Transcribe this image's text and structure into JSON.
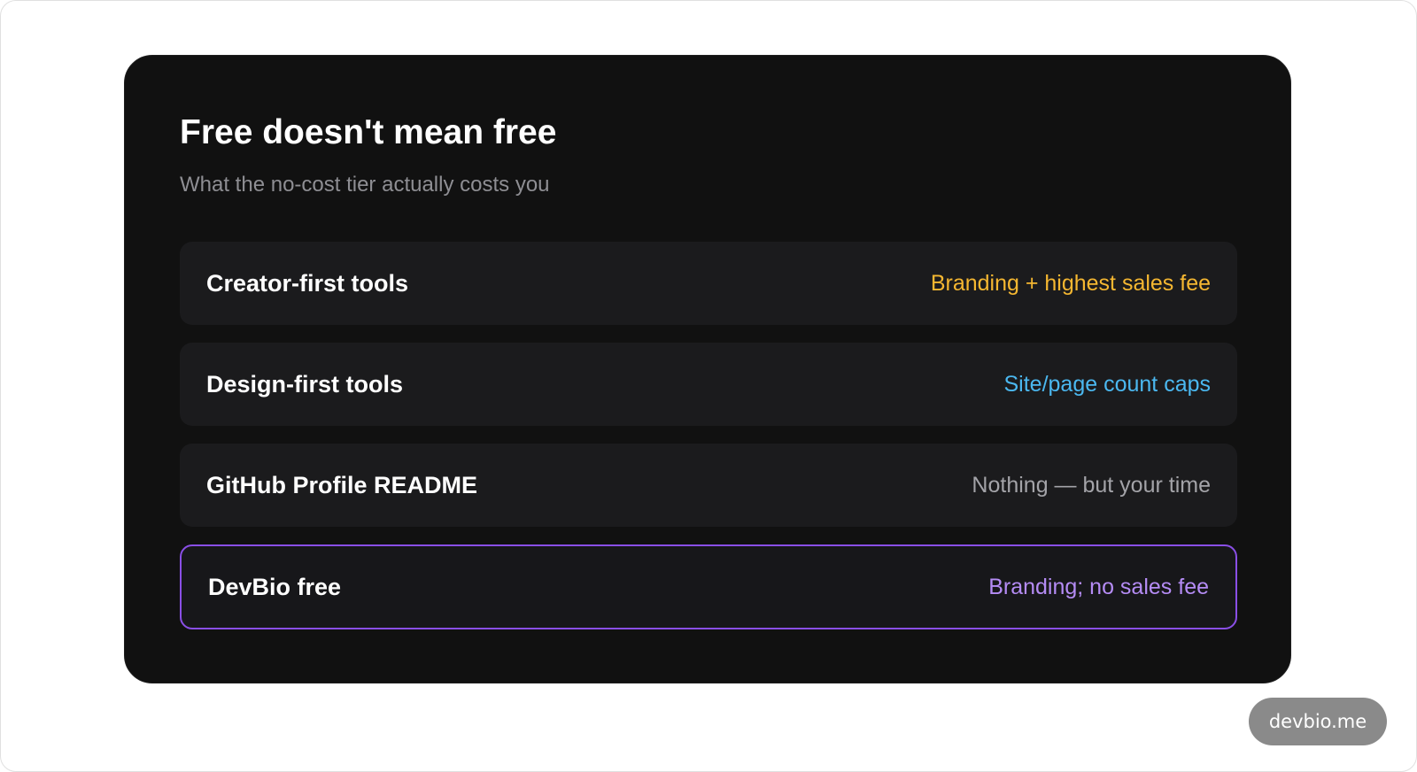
{
  "card": {
    "title": "Free doesn't mean free",
    "subtitle": "What the no-cost tier actually costs you"
  },
  "rows": [
    {
      "label": "Creator-first tools",
      "value": "Branding + highest sales fee",
      "value_color": "#f5b731",
      "highlighted": false
    },
    {
      "label": "Design-first tools",
      "value": "Site/page count caps",
      "value_color": "#4bb8f0",
      "highlighted": false
    },
    {
      "label": "GitHub Profile README",
      "value": "Nothing — but your time",
      "value_color": "#a3a3a8",
      "highlighted": false
    },
    {
      "label": "DevBio free",
      "value": "Branding; no sales fee",
      "value_color": "#b58cf5",
      "highlighted": true,
      "border_color": "#8a4fe6"
    }
  ],
  "watermark": {
    "text": "devbio.me"
  }
}
